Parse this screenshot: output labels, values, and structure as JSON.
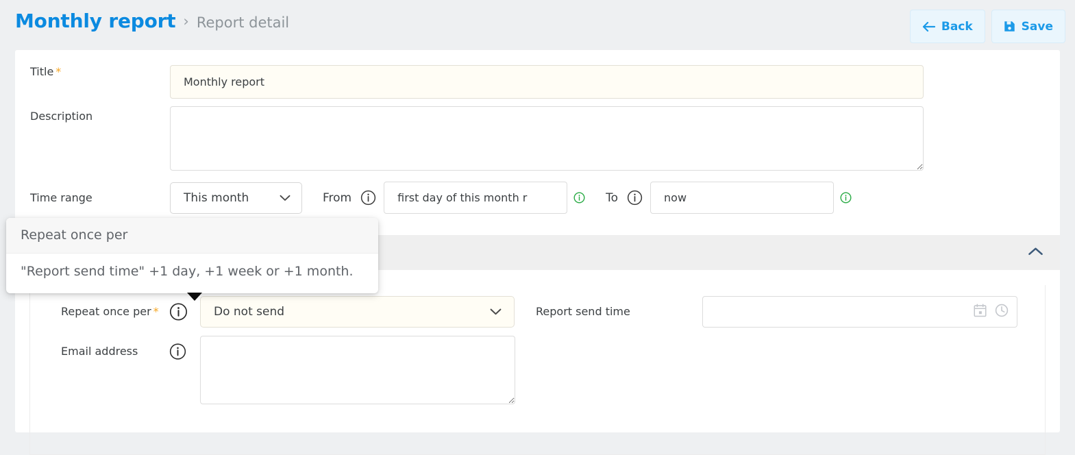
{
  "header": {
    "breadcrumb_main": "Monthly report",
    "breadcrumb_separator": "›",
    "breadcrumb_sub": "Report detail",
    "back_label": "Back",
    "save_label": "Save",
    "back_icon": "arrow-left-icon",
    "save_icon": "floppy-disk-icon",
    "accent_color": "#0b8ae0"
  },
  "form": {
    "title_label": "Title",
    "title_required_marker": "*",
    "title_value": "Monthly report",
    "title_placeholder": "",
    "description_label": "Description",
    "description_value": "",
    "description_placeholder": "",
    "time_range_label": "Time range",
    "time_range_value": "This month",
    "time_range_options": [
      "This month"
    ],
    "from_label": "From",
    "from_value": "first day of this month r",
    "from_placeholder": "",
    "to_label": "To",
    "to_value": "now",
    "to_placeholder": "",
    "info_icon": "info-circle-icon",
    "valid_icon": "info-circle-green-icon",
    "chevron_down_icon": "chevron-down-icon"
  },
  "section": {
    "collapse_icon": "chevron-up-icon",
    "repeat_label": "Repeat once per",
    "repeat_required_marker": "*",
    "repeat_value": "Do not send",
    "repeat_options": [
      "Do not send"
    ],
    "send_time_label": "Report send time",
    "send_time_value": "",
    "send_time_placeholder": "",
    "send_time_calendar_icon": "calendar-icon",
    "send_time_clock_icon": "clock-icon",
    "email_label": "Email address",
    "email_value": "",
    "email_placeholder": "",
    "info_icon": "info-circle-icon"
  },
  "tooltip": {
    "title": "Repeat once per",
    "body": "\"Report send time\" +1 day, +1 week or +1 month."
  },
  "colors": {
    "page_background": "#eef0f2",
    "card_background": "#ffffff",
    "section_header": "#efefef",
    "required_marker": "#f5a623",
    "input_highlight": "#fffdf5",
    "valid_green": "#28a745"
  }
}
